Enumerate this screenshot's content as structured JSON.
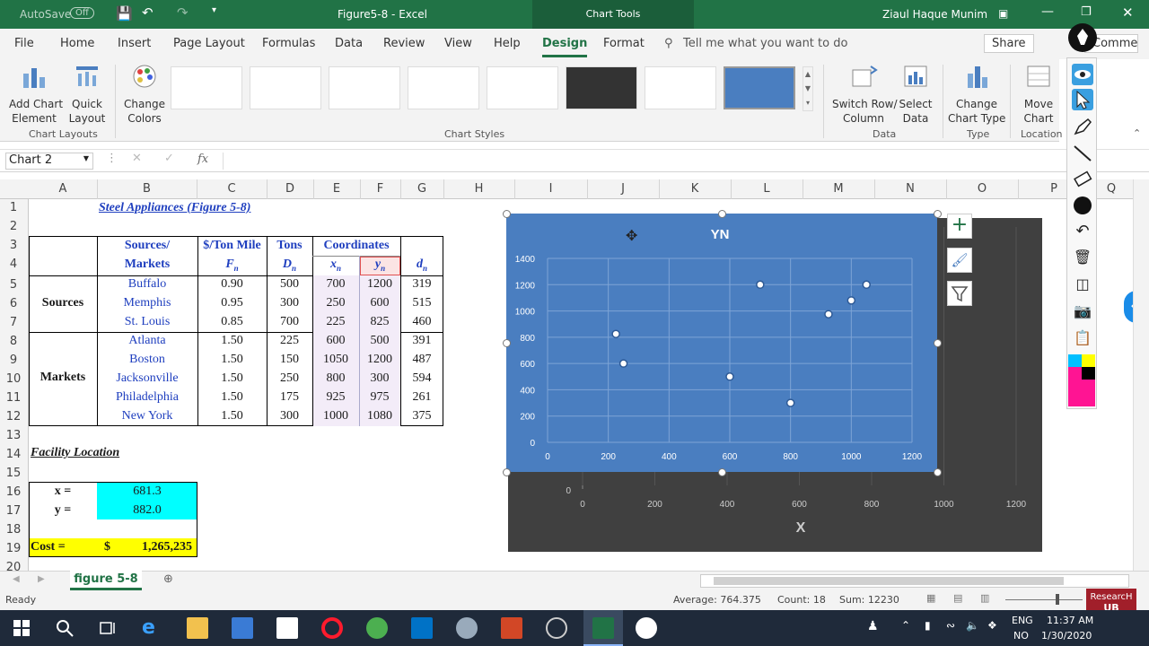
{
  "titlebar": {
    "autosave": "AutoSave",
    "autosave_state": "Off",
    "doc_title": "Figure5-8  -  Excel",
    "context_tab": "Chart Tools",
    "user": "Ziaul Haque Munim"
  },
  "menu": {
    "items": [
      "File",
      "Home",
      "Insert",
      "Page Layout",
      "Formulas",
      "Data",
      "Review",
      "View",
      "Help",
      "Design",
      "Format"
    ],
    "active": "Design",
    "tell": "Tell me what you want to do",
    "share": "Share",
    "comments": "Comments"
  },
  "ribbon": {
    "add_chart": "Add Chart",
    "add_chart2": "Element",
    "quick": "Quick",
    "quick2": "Layout",
    "change_colors": "Change",
    "change_colors2": "Colors",
    "switch": "Switch Row/",
    "switch2": "Column",
    "select": "Select",
    "select2": "Data",
    "change_type": "Change",
    "change_type2": "Chart Type",
    "move": "Move",
    "move2": "Chart",
    "grp_layouts": "Chart Layouts",
    "grp_styles": "Chart Styles",
    "grp_data": "Data",
    "grp_type": "Type",
    "grp_location": "Location"
  },
  "formula": {
    "name_box": "Chart 2",
    "fx": "fx"
  },
  "columns": [
    "A",
    "B",
    "C",
    "D",
    "E",
    "F",
    "G",
    "H",
    "I",
    "J",
    "K",
    "L",
    "M",
    "N",
    "O",
    "P",
    "Q"
  ],
  "rows": [
    "1",
    "2",
    "3",
    "4",
    "5",
    "6",
    "7",
    "8",
    "9",
    "10",
    "11",
    "12",
    "13",
    "14",
    "15",
    "16",
    "17",
    "18",
    "19",
    "20"
  ],
  "sheet": {
    "title": "Steel Appliances (Figure 5-8)",
    "h_sources": "Sources/",
    "h_markets": "Markets",
    "h_rate": "$/Ton Mile",
    "h_F": "F",
    "h_tons": "Tons",
    "h_D": "D",
    "h_coords": "Coordinates",
    "h_x": "x",
    "h_y": "y",
    "h_d": "d",
    "sub_n": "n",
    "grp_sources": "Sources",
    "grp_markets": "Markets",
    "rows": [
      {
        "name": "Buffalo",
        "F": "0.90",
        "D": "500",
        "x": "700",
        "y": "1200",
        "d": "319"
      },
      {
        "name": "Memphis",
        "F": "0.95",
        "D": "300",
        "x": "250",
        "y": "600",
        "d": "515"
      },
      {
        "name": "St. Louis",
        "F": "0.85",
        "D": "700",
        "x": "225",
        "y": "825",
        "d": "460"
      },
      {
        "name": "Atlanta",
        "F": "1.50",
        "D": "225",
        "x": "600",
        "y": "500",
        "d": "391"
      },
      {
        "name": "Boston",
        "F": "1.50",
        "D": "150",
        "x": "1050",
        "y": "1200",
        "d": "487"
      },
      {
        "name": "Jacksonville",
        "F": "1.50",
        "D": "250",
        "x": "800",
        "y": "300",
        "d": "594"
      },
      {
        "name": "Philadelphia",
        "F": "1.50",
        "D": "175",
        "x": "925",
        "y": "975",
        "d": "261"
      },
      {
        "name": "New York",
        "F": "1.50",
        "D": "300",
        "x": "1000",
        "y": "1080",
        "d": "375"
      }
    ],
    "fac_title": "Facility Location",
    "x_label": "x =",
    "x_val": "681.3",
    "y_label": "y =",
    "y_val": "882.0",
    "cost_label": "Cost =",
    "cost_cur": "$",
    "cost_val": "1,265,235"
  },
  "chart_data": [
    {
      "type": "scatter",
      "title": "YN",
      "xlabel": "",
      "ylabel": "",
      "xlim": [
        0,
        1200
      ],
      "ylim": [
        0,
        1400
      ],
      "xticks": [
        "0",
        "200",
        "400",
        "600",
        "800",
        "1000",
        "1200"
      ],
      "yticks": [
        "0",
        "200",
        "400",
        "600",
        "800",
        "1000",
        "1200",
        "1400"
      ],
      "grid": true,
      "series": [
        {
          "x": [
            700,
            250,
            225,
            600,
            1050,
            800,
            925,
            1000
          ],
          "y": [
            1200,
            600,
            825,
            500,
            1200,
            300,
            975,
            1080
          ]
        }
      ]
    },
    {
      "type": "scatter",
      "title": "",
      "xlabel": "X",
      "ylabel": "",
      "xlim": [
        0,
        1200
      ],
      "xticks": [
        "0",
        "200",
        "400",
        "600",
        "800",
        "1000",
        "1200"
      ],
      "yticks": [
        "0"
      ]
    }
  ],
  "tabs": {
    "sheet": "figure 5-8"
  },
  "status": {
    "ready": "Ready",
    "average": "Average: 764.375",
    "count": "Count: 18",
    "sum": "Sum: 12230"
  },
  "taskbar": {
    "lang1": "ENG",
    "lang2": "NO",
    "time": "11:37 AM",
    "date": "1/30/2020"
  },
  "badge": {
    "name": "ResearcH",
    "sub": "UB"
  },
  "colors": {
    "excel_green": "#217346",
    "chart_blue": "#4a7ec0",
    "dark_chart": "#404040",
    "cyan": "#00ffff",
    "yellow": "#ffff00"
  }
}
